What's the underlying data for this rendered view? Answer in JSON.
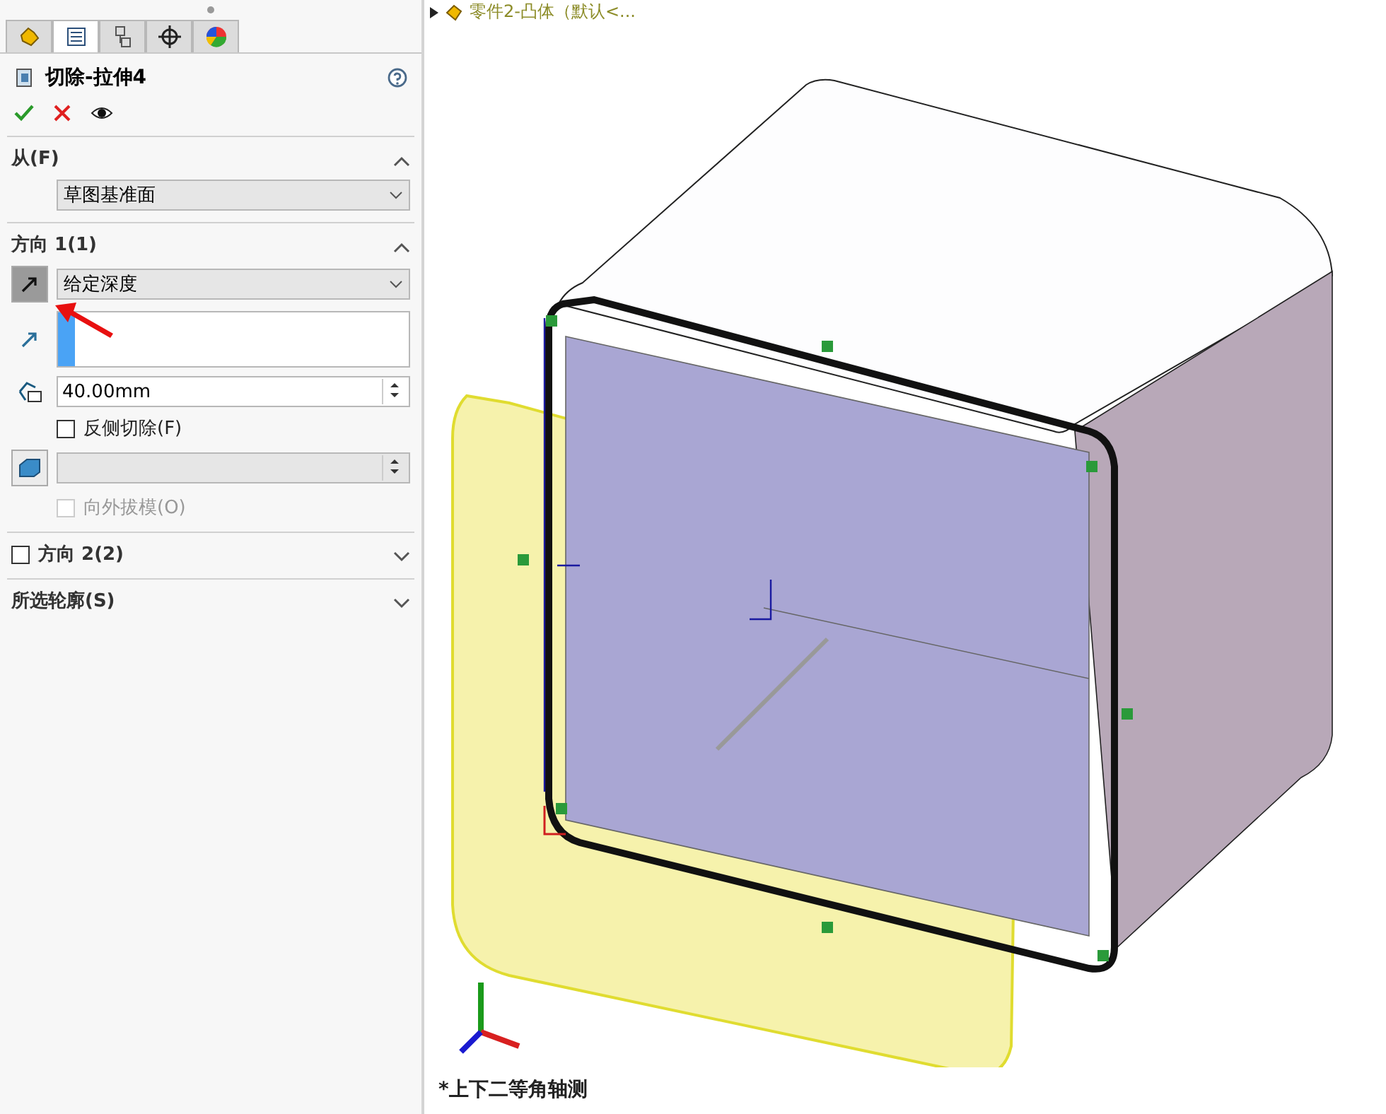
{
  "panel": {
    "tabs": [
      {
        "kind": "feature",
        "selected": false
      },
      {
        "kind": "property",
        "selected": true
      },
      {
        "kind": "config",
        "selected": false
      },
      {
        "kind": "dim",
        "selected": false
      },
      {
        "kind": "display",
        "selected": false
      }
    ],
    "feature_title": "切除-拉伸4",
    "sections": [
      {
        "kind": "from",
        "label": "从(F)",
        "expanded": true,
        "select": "草图基准面"
      },
      {
        "kind": "dir1",
        "label": "方向 1(1)",
        "expanded": true,
        "select": "给定深度",
        "depth": "40.00mm",
        "flip": {
          "label": "反侧切除(F)",
          "checked": false
        },
        "draft": {
          "label": "向外拔模(O)",
          "checked": false,
          "disabled": true
        }
      },
      {
        "kind": "dir2",
        "label": "方向 2(2)",
        "expanded": false,
        "checked": false
      },
      {
        "kind": "contours",
        "label": "所选轮廓(S)",
        "expanded": false
      }
    ]
  },
  "viewport": {
    "tree_path": "零件2-凸体（默认<...",
    "view_label": "*上下二等角轴测"
  }
}
